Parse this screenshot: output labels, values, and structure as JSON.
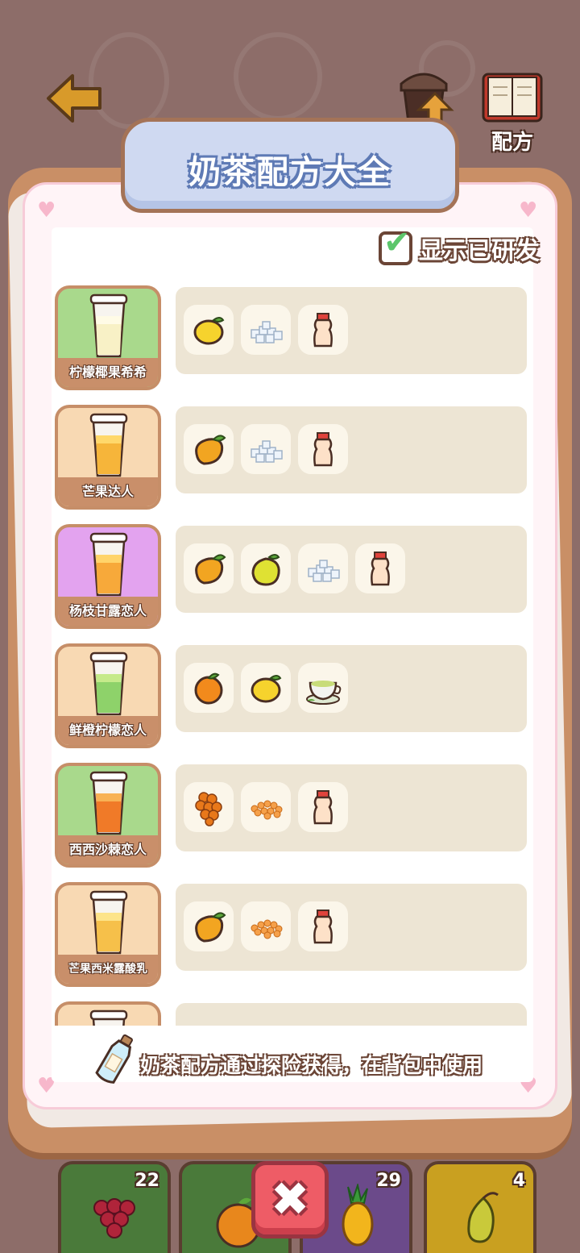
{
  "header": {
    "title": "奶茶配方大全",
    "upgrade_label": "升级",
    "recipe_label": "配方"
  },
  "filter": {
    "show_developed_label": "显示已研发",
    "show_developed_checked": true
  },
  "recipes": [
    {
      "name": "柠檬椰果希希",
      "card_color": "#a9d98c",
      "ingredients": [
        "lemon-icon",
        "sugar-cubes-icon",
        "yakult-bottle-icon"
      ]
    },
    {
      "name": "芒果达人",
      "card_color": "#f8d9b3",
      "ingredients": [
        "mango-icon",
        "sugar-cubes-icon",
        "yakult-bottle-icon"
      ]
    },
    {
      "name": "杨枝甘露恋人",
      "card_color": "#e3a3ef",
      "ingredients": [
        "mango-icon",
        "pomelo-icon",
        "sugar-cubes-icon",
        "yakult-bottle-icon"
      ]
    },
    {
      "name": "鲜橙柠檬恋人",
      "card_color": "#f8d9b3",
      "ingredients": [
        "orange-icon",
        "lemon-icon",
        "green-tea-icon"
      ]
    },
    {
      "name": "西西沙棘恋人",
      "card_color": "#a9d98c",
      "ingredients": [
        "sea-buckthorn-icon",
        "tapioca-pearls-icon",
        "yakult-bottle-icon"
      ]
    },
    {
      "name": "芒果西米露酸乳",
      "card_color": "#f8d9b3",
      "ingredients": [
        "mango-icon",
        "tapioca-pearls-icon",
        "yakult-bottle-icon"
      ]
    },
    {
      "name": "",
      "card_color": "#f8d9b3",
      "ingredients": []
    }
  ],
  "hint": {
    "text": "奶茶配方通过探险获得，在背包中使用"
  },
  "bottom_bar": {
    "slots": [
      {
        "item": "grape-icon",
        "count": "22",
        "color": "#4a7a3a"
      },
      {
        "item": "orange-icon",
        "count": "",
        "color": "#4a7a3a"
      },
      {
        "item": "pineapple-icon",
        "count": "29",
        "color": "#6b4a8a"
      },
      {
        "item": "pear-icon",
        "count": "4",
        "color": "#c9a020"
      }
    ],
    "close_label": "✖"
  },
  "colors": {
    "panel_wood": "#c98f66",
    "panel_inner": "#fff4f7",
    "title_bg": "#cfd9f1",
    "ingredient_panel": "#ede5d4"
  }
}
